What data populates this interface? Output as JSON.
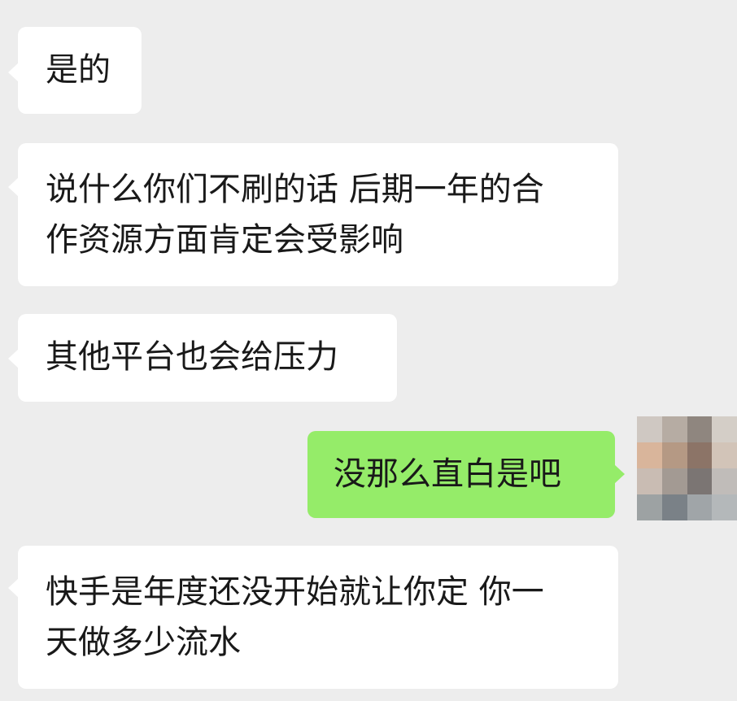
{
  "chat": {
    "messages": [
      {
        "side": "left",
        "lines": [
          "是的"
        ]
      },
      {
        "side": "left",
        "lines": [
          "说什么你们不刷的话 后期一年的合",
          "作资源方面肯定会受影响"
        ]
      },
      {
        "side": "left",
        "lines": [
          "其他平台也会给压力"
        ]
      },
      {
        "side": "right",
        "lines": [
          "没那么直白是吧"
        ]
      },
      {
        "side": "left",
        "lines": [
          "快手是年度还没开始就让你定 你一",
          "天做多少流水"
        ]
      }
    ],
    "avatar": {
      "description_icon": "pixelated-avatar",
      "pixels": [
        "#cfc8c2",
        "#b6aca3",
        "#8f867f",
        "#d4cec7",
        "#d9b59b",
        "#b59984",
        "#8c7467",
        "#d2c4b8",
        "#c9bcb3",
        "#a39a93",
        "#7b7573",
        "#c0bcb9",
        "#9da2a3",
        "#7a8187",
        "#a0a5a8",
        "#b4b8ba"
      ]
    }
  },
  "colors": {
    "background": "#ededed",
    "bubble_incoming": "#ffffff",
    "bubble_outgoing": "#95ec69",
    "text": "#191919"
  }
}
